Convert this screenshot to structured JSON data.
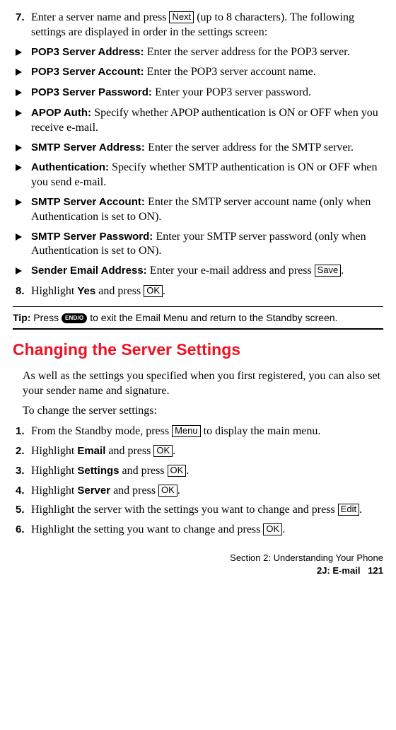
{
  "step7": {
    "num": "7.",
    "text_before": "Enter a server name and press ",
    "btn": "Next",
    "text_after": " (up to 8 characters). The following settings are displayed in order in the settings screen:"
  },
  "bullets": [
    {
      "label": "POP3 Server Address: ",
      "desc": "Enter the server address for the POP3 server."
    },
    {
      "label": "POP3 Server Account: ",
      "desc": "Enter the POP3 server account name."
    },
    {
      "label": "POP3 Server Password: ",
      "desc": "Enter your POP3 server password."
    },
    {
      "label": "APOP Auth: ",
      "desc": "Specify whether APOP authentication is ON or OFF when you receive e-mail."
    },
    {
      "label": "SMTP Server Address: ",
      "desc": "Enter the server address for the SMTP server."
    },
    {
      "label": "Authentication: ",
      "desc": "Specify whether SMTP authentication is ON or OFF when you send e-mail."
    },
    {
      "label": "SMTP Server Account: ",
      "desc": "Enter the SMTP server account name (only when Authentication is set to ON)."
    },
    {
      "label": "SMTP Server Password: ",
      "desc": "Enter your SMTP server password (only when Authentication is set to ON)."
    }
  ],
  "sender_bullet": {
    "label": "Sender Email Address: ",
    "before": "Enter your e-mail address and press ",
    "btn": "Save",
    "after": "."
  },
  "step8": {
    "num": "8.",
    "before": "Highlight ",
    "bold": "Yes",
    "mid": " and press ",
    "btn": "OK",
    "after": "."
  },
  "tip": {
    "lead": "Tip: ",
    "before": "Press ",
    "key": "END/O",
    "after": " to exit the Email Menu and return to the Standby screen."
  },
  "heading": "Changing the Server Settings",
  "intro1": "As well as the settings you specified when you first registered, you can also set your sender name and signature.",
  "intro2": "To change the server settings:",
  "steps": {
    "s1": {
      "num": "1.",
      "before": "From the Standby mode, press ",
      "btn": "Menu",
      "after": " to display the main menu."
    },
    "s2": {
      "num": "2.",
      "before": "Highlight ",
      "bold": "Email",
      "mid": " and press ",
      "btn": "OK",
      "after": "."
    },
    "s3": {
      "num": "3.",
      "before": "Highlight ",
      "bold": "Settings",
      "mid": " and press ",
      "btn": "OK",
      "after": "."
    },
    "s4": {
      "num": "4.",
      "before": "Highlight ",
      "bold": "Server",
      "mid": " and press ",
      "btn": "OK",
      "after": "."
    },
    "s5": {
      "num": "5.",
      "before": "Highlight the server with the settings you want to change and press ",
      "btn": "Edit",
      "after": "."
    },
    "s6": {
      "num": "6.",
      "before": "Highlight the setting you want to change and press ",
      "btn": "OK",
      "after": "."
    }
  },
  "footer": {
    "line1": "Section 2: Understanding Your Phone",
    "line2a": "2J: E-mail",
    "page": "121"
  }
}
